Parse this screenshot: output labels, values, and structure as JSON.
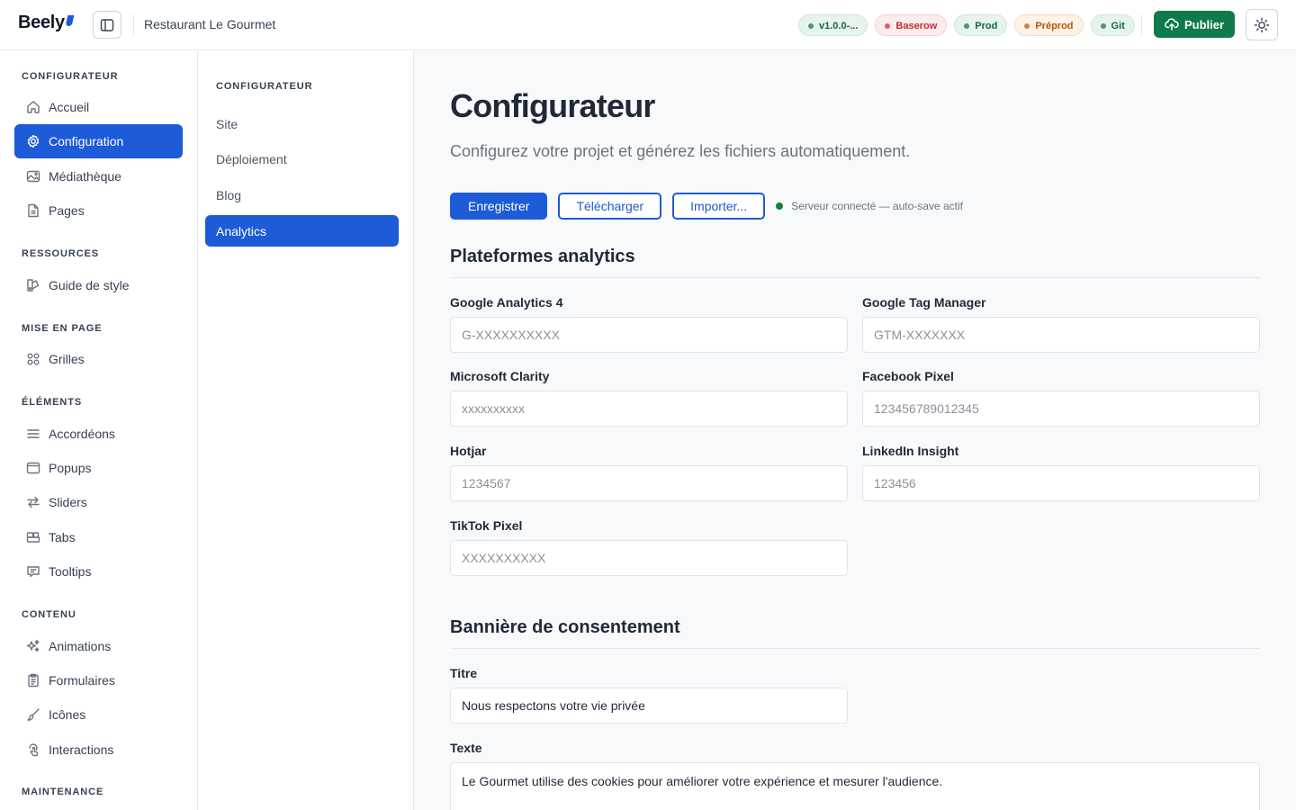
{
  "header": {
    "logo": "Beely",
    "project": "Restaurant Le Gourmet",
    "pills": [
      {
        "label": "v1.0.0-...",
        "tone": "green"
      },
      {
        "label": "Baserow",
        "tone": "red"
      },
      {
        "label": "Prod",
        "tone": "green"
      },
      {
        "label": "Préprod",
        "tone": "orange"
      },
      {
        "label": "Git",
        "tone": "green"
      }
    ],
    "publish_label": "Publier"
  },
  "sidebar": {
    "sections": [
      {
        "title": "CONFIGURATEUR",
        "items": [
          {
            "label": "Accueil",
            "icon": "home-icon"
          },
          {
            "label": "Configuration",
            "icon": "gear-icon",
            "active": true
          },
          {
            "label": "Médiathèque",
            "icon": "image-icon"
          },
          {
            "label": "Pages",
            "icon": "page-icon"
          }
        ]
      },
      {
        "title": "RESSOURCES",
        "items": [
          {
            "label": "Guide de style",
            "icon": "palette-icon"
          }
        ]
      },
      {
        "title": "MISE EN PAGE",
        "items": [
          {
            "label": "Grilles",
            "icon": "grid-icon"
          }
        ]
      },
      {
        "title": "ÉLÉMENTS",
        "items": [
          {
            "label": "Accordéons",
            "icon": "menu-lines-icon"
          },
          {
            "label": "Popups",
            "icon": "window-icon"
          },
          {
            "label": "Sliders",
            "icon": "arrows-swap-icon"
          },
          {
            "label": "Tabs",
            "icon": "tabs-icon"
          },
          {
            "label": "Tooltips",
            "icon": "chat-icon"
          }
        ]
      },
      {
        "title": "CONTENU",
        "items": [
          {
            "label": "Animations",
            "icon": "sparkle-icon"
          },
          {
            "label": "Formulaires",
            "icon": "clipboard-icon"
          },
          {
            "label": "Icônes",
            "icon": "brush-icon"
          },
          {
            "label": "Interactions",
            "icon": "touch-icon"
          }
        ]
      },
      {
        "title": "MAINTENANCE",
        "items": []
      }
    ]
  },
  "subnav": {
    "title": "CONFIGURATEUR",
    "items": [
      {
        "label": "Site"
      },
      {
        "label": "Déploiement"
      },
      {
        "label": "Blog"
      },
      {
        "label": "Analytics",
        "active": true
      }
    ]
  },
  "main": {
    "title": "Configurateur",
    "lead": "Configurez votre projet et générez les fichiers automatiquement.",
    "buttons": {
      "save": "Enregistrer",
      "download": "Télécharger",
      "import": "Importer..."
    },
    "status": "Serveur connecté — auto-save actif",
    "analytics": {
      "heading": "Plateformes analytics",
      "fields": [
        {
          "label": "Google Analytics 4",
          "placeholder": "G-XXXXXXXXXX"
        },
        {
          "label": "Google Tag Manager",
          "placeholder": "GTM-XXXXXXX"
        },
        {
          "label": "Microsoft Clarity",
          "placeholder": "xxxxxxxxxx"
        },
        {
          "label": "Facebook Pixel",
          "placeholder": "123456789012345"
        },
        {
          "label": "Hotjar",
          "placeholder": "1234567"
        },
        {
          "label": "LinkedIn Insight",
          "placeholder": "123456"
        },
        {
          "label": "TikTok Pixel",
          "placeholder": "XXXXXXXXXX"
        }
      ]
    },
    "consent": {
      "heading": "Bannière de consentement",
      "title_label": "Titre",
      "title_value": "Nous respectons votre vie privée",
      "text_label": "Texte",
      "text_value": "Le Gourmet utilise des cookies pour améliorer votre expérience et mesurer l'audience."
    }
  }
}
